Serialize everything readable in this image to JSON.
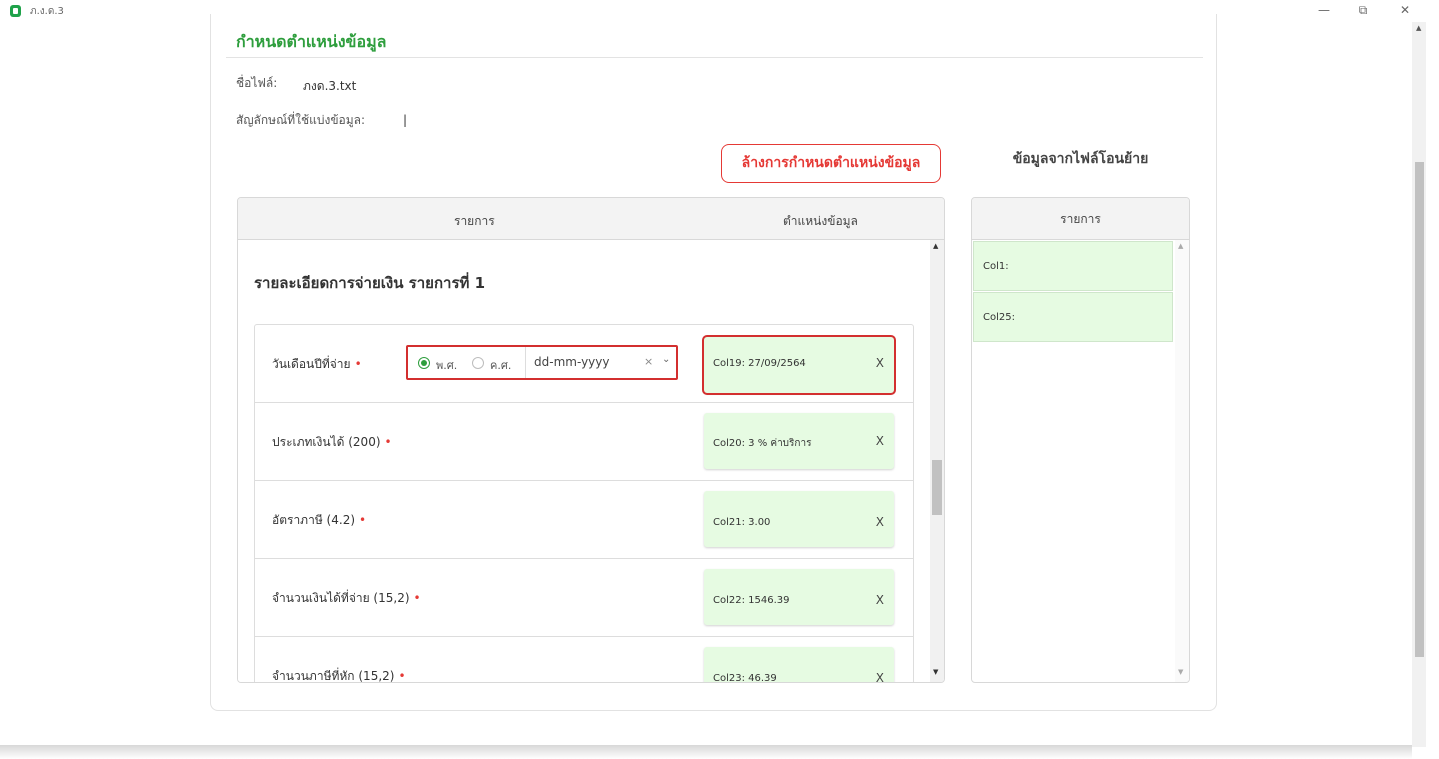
{
  "window": {
    "title": "ภ.ง.ด.3",
    "controls": {
      "minimize": "—",
      "restore": "⧉",
      "close": "✕"
    }
  },
  "page": {
    "title": "กำหนดตำแหน่งข้อมูล",
    "file_label": "ชื่อไฟล์:",
    "file_name": "ภงด.3.txt",
    "delimiter_label": "สัญลักษณ์ที่ใช้แบ่งข้อมูล:",
    "delimiter_value": "|",
    "clear_button": "ล้างการกำหนดตำแหน่งข้อมูล",
    "right_heading": "ข้อมูลจากไฟล์โอนย้าย"
  },
  "main_table": {
    "headers": {
      "item": "รายการ",
      "position": "ตำแหน่งข้อมูล"
    },
    "section_title": "รายละเอียดการจ่ายเงิน รายการที่ 1",
    "date_picker": {
      "buddhist_label": "พ.ศ.",
      "christian_label": "ค.ศ.",
      "selected_era": "พ.ศ.",
      "value": "dd-mm-yyyy",
      "clear_glyph": "×",
      "chevron_glyph": "⌄"
    },
    "rows": [
      {
        "label": "วันเดือนปีที่จ่าย",
        "required": "•",
        "value": "Col19: 27/09/2564",
        "remove": "X"
      },
      {
        "label": "ประเภทเงินได้ (200)",
        "required": "•",
        "value": "Col20: 3 % ค่าบริการ",
        "remove": "X"
      },
      {
        "label": "อัตราภาษี (4.2)",
        "required": "•",
        "value": "Col21: 3.00",
        "remove": "X"
      },
      {
        "label": "จำนวนเงินได้ที่จ่าย (15,2)",
        "required": "•",
        "value": "Col22: 1546.39",
        "remove": "X"
      },
      {
        "label": "จำนวนภาษีที่หัก (15,2)",
        "required": "•",
        "value": "Col23: 46.39",
        "remove": "X"
      }
    ]
  },
  "side_table": {
    "header": "รายการ",
    "items": [
      "Col1:",
      "Col25:"
    ]
  },
  "scroll_glyphs": {
    "up": "▲",
    "down": "▼"
  },
  "colors": {
    "accent_green": "#2e9e3d",
    "danger_red": "#e53935",
    "mapped_bg": "#e6fbe2"
  }
}
